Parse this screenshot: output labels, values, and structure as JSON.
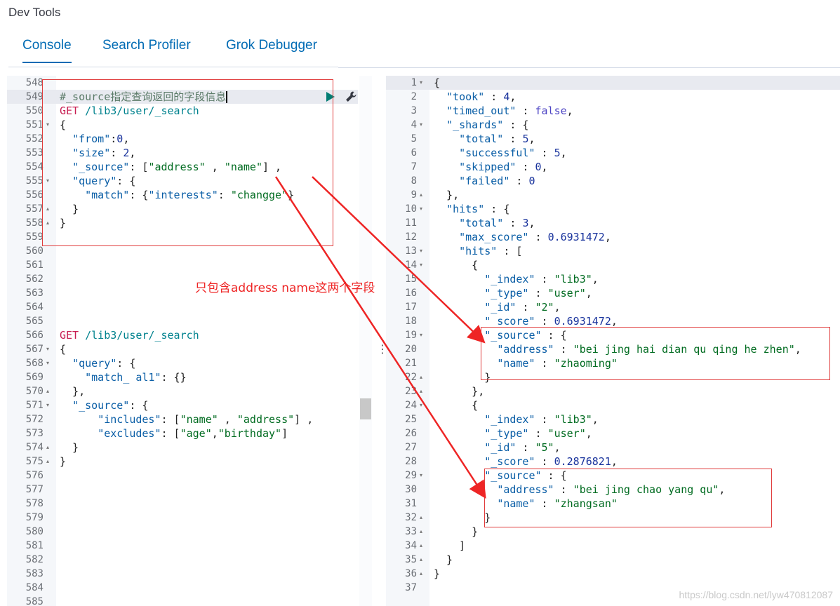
{
  "app": {
    "title": "Dev Tools"
  },
  "tabs": [
    {
      "label": "Console",
      "active": true
    },
    {
      "label": "Search Profiler",
      "active": false
    },
    {
      "label": "Grok Debugger",
      "active": false
    }
  ],
  "request_editor": {
    "lines": [
      {
        "num": "548",
        "tokens": []
      },
      {
        "num": "549",
        "tokens": [
          [
            "cmt",
            "#_source指定查询返回的字段信息"
          ]
        ],
        "cursor": true
      },
      {
        "num": "550",
        "tokens": [
          [
            "verb",
            "GET"
          ],
          [
            "pun",
            " "
          ],
          [
            "url",
            "/lib3/user/_search"
          ]
        ]
      },
      {
        "num": "551",
        "fold": "▾",
        "tokens": [
          [
            "pun",
            "{"
          ]
        ]
      },
      {
        "num": "552",
        "tokens": [
          [
            "pun",
            "  "
          ],
          [
            "key",
            "\"from\""
          ],
          [
            "pun",
            ":"
          ],
          [
            "num",
            "0"
          ],
          [
            "pun",
            ","
          ]
        ]
      },
      {
        "num": "553",
        "tokens": [
          [
            "pun",
            "  "
          ],
          [
            "key",
            "\"size\""
          ],
          [
            "pun",
            ": "
          ],
          [
            "num",
            "2"
          ],
          [
            "pun",
            ","
          ]
        ]
      },
      {
        "num": "554",
        "tokens": [
          [
            "pun",
            "  "
          ],
          [
            "key",
            "\"_source\""
          ],
          [
            "pun",
            ": ["
          ],
          [
            "str",
            "\"address\""
          ],
          [
            "pun",
            " , "
          ],
          [
            "str",
            "\"name\""
          ],
          [
            "pun",
            "] ,"
          ]
        ]
      },
      {
        "num": "555",
        "fold": "▾",
        "tokens": [
          [
            "pun",
            "  "
          ],
          [
            "key",
            "\"query\""
          ],
          [
            "pun",
            ": {"
          ]
        ]
      },
      {
        "num": "556",
        "tokens": [
          [
            "pun",
            "    "
          ],
          [
            "key",
            "\"match\""
          ],
          [
            "pun",
            ": {"
          ],
          [
            "key",
            "\"interests\""
          ],
          [
            "pun",
            ": "
          ],
          [
            "str",
            "\"changge\""
          ],
          [
            "pun",
            "}"
          ]
        ]
      },
      {
        "num": "557",
        "fold": "▴",
        "tokens": [
          [
            "pun",
            "  }"
          ]
        ]
      },
      {
        "num": "558",
        "fold": "▴",
        "tokens": [
          [
            "pun",
            "}"
          ]
        ]
      },
      {
        "num": "559",
        "tokens": []
      },
      {
        "num": "560",
        "tokens": []
      },
      {
        "num": "561",
        "tokens": []
      },
      {
        "num": "562",
        "tokens": []
      },
      {
        "num": "563",
        "tokens": []
      },
      {
        "num": "564",
        "tokens": []
      },
      {
        "num": "565",
        "tokens": []
      },
      {
        "num": "566",
        "tokens": [
          [
            "verb",
            "GET"
          ],
          [
            "pun",
            " "
          ],
          [
            "url",
            "/lib3/user/_search"
          ]
        ]
      },
      {
        "num": "567",
        "fold": "▾",
        "tokens": [
          [
            "pun",
            "{"
          ]
        ]
      },
      {
        "num": "568",
        "fold": "▾",
        "tokens": [
          [
            "pun",
            "  "
          ],
          [
            "key",
            "\"query\""
          ],
          [
            "pun",
            ": {"
          ]
        ]
      },
      {
        "num": "569",
        "tokens": [
          [
            "pun",
            "    "
          ],
          [
            "key",
            "\"match_ al1\""
          ],
          [
            "pun",
            ": {}"
          ]
        ]
      },
      {
        "num": "570",
        "fold": "▴",
        "tokens": [
          [
            "pun",
            "  },"
          ]
        ]
      },
      {
        "num": "571",
        "fold": "▾",
        "tokens": [
          [
            "pun",
            "  "
          ],
          [
            "key",
            "\"_source\""
          ],
          [
            "pun",
            ": {"
          ]
        ]
      },
      {
        "num": "572",
        "tokens": [
          [
            "pun",
            "      "
          ],
          [
            "key",
            "\"includes\""
          ],
          [
            "pun",
            ": ["
          ],
          [
            "str",
            "\"name\""
          ],
          [
            "pun",
            " , "
          ],
          [
            "str",
            "\"address\""
          ],
          [
            "pun",
            "] ,"
          ]
        ]
      },
      {
        "num": "573",
        "tokens": [
          [
            "pun",
            "      "
          ],
          [
            "key",
            "\"excludes\""
          ],
          [
            "pun",
            ": ["
          ],
          [
            "str",
            "\"age\""
          ],
          [
            "pun",
            ","
          ],
          [
            "str",
            "\"birthday\""
          ],
          [
            "pun",
            "]"
          ]
        ]
      },
      {
        "num": "574",
        "fold": "▴",
        "tokens": [
          [
            "pun",
            "  }"
          ]
        ]
      },
      {
        "num": "575",
        "fold": "▴",
        "tokens": [
          [
            "pun",
            "}"
          ]
        ]
      },
      {
        "num": "576",
        "tokens": []
      },
      {
        "num": "577",
        "tokens": []
      },
      {
        "num": "578",
        "tokens": []
      },
      {
        "num": "579",
        "tokens": []
      },
      {
        "num": "580",
        "tokens": []
      },
      {
        "num": "581",
        "tokens": []
      },
      {
        "num": "582",
        "tokens": []
      },
      {
        "num": "583",
        "tokens": []
      },
      {
        "num": "584",
        "tokens": []
      },
      {
        "num": "585",
        "tokens": []
      }
    ],
    "run_icon": "play-icon",
    "settings_icon": "wrench-icon"
  },
  "response_viewer": {
    "lines": [
      {
        "num": "1",
        "fold": "▾",
        "tokens": [
          [
            "pun",
            "{"
          ]
        ]
      },
      {
        "num": "2",
        "tokens": [
          [
            "pun",
            "  "
          ],
          [
            "key",
            "\"took\""
          ],
          [
            "pun",
            " : "
          ],
          [
            "num",
            "4"
          ],
          [
            "pun",
            ","
          ]
        ]
      },
      {
        "num": "3",
        "tokens": [
          [
            "pun",
            "  "
          ],
          [
            "key",
            "\"timed_out\""
          ],
          [
            "pun",
            " : "
          ],
          [
            "bool",
            "false"
          ],
          [
            "pun",
            ","
          ]
        ]
      },
      {
        "num": "4",
        "fold": "▾",
        "tokens": [
          [
            "pun",
            "  "
          ],
          [
            "key",
            "\"_shards\""
          ],
          [
            "pun",
            " : {"
          ]
        ]
      },
      {
        "num": "5",
        "tokens": [
          [
            "pun",
            "    "
          ],
          [
            "key",
            "\"total\""
          ],
          [
            "pun",
            " : "
          ],
          [
            "num",
            "5"
          ],
          [
            "pun",
            ","
          ]
        ]
      },
      {
        "num": "6",
        "tokens": [
          [
            "pun",
            "    "
          ],
          [
            "key",
            "\"successful\""
          ],
          [
            "pun",
            " : "
          ],
          [
            "num",
            "5"
          ],
          [
            "pun",
            ","
          ]
        ]
      },
      {
        "num": "7",
        "tokens": [
          [
            "pun",
            "    "
          ],
          [
            "key",
            "\"skipped\""
          ],
          [
            "pun",
            " : "
          ],
          [
            "num",
            "0"
          ],
          [
            "pun",
            ","
          ]
        ]
      },
      {
        "num": "8",
        "tokens": [
          [
            "pun",
            "    "
          ],
          [
            "key",
            "\"failed\""
          ],
          [
            "pun",
            " : "
          ],
          [
            "num",
            "0"
          ]
        ]
      },
      {
        "num": "9",
        "fold": "▴",
        "tokens": [
          [
            "pun",
            "  },"
          ]
        ]
      },
      {
        "num": "10",
        "fold": "▾",
        "tokens": [
          [
            "pun",
            "  "
          ],
          [
            "key",
            "\"hits\""
          ],
          [
            "pun",
            " : {"
          ]
        ]
      },
      {
        "num": "11",
        "tokens": [
          [
            "pun",
            "    "
          ],
          [
            "key",
            "\"total\""
          ],
          [
            "pun",
            " : "
          ],
          [
            "num",
            "3"
          ],
          [
            "pun",
            ","
          ]
        ]
      },
      {
        "num": "12",
        "tokens": [
          [
            "pun",
            "    "
          ],
          [
            "key",
            "\"max_score\""
          ],
          [
            "pun",
            " : "
          ],
          [
            "num",
            "0.6931472"
          ],
          [
            "pun",
            ","
          ]
        ]
      },
      {
        "num": "13",
        "fold": "▾",
        "tokens": [
          [
            "pun",
            "    "
          ],
          [
            "key",
            "\"hits\""
          ],
          [
            "pun",
            " : ["
          ]
        ]
      },
      {
        "num": "14",
        "fold": "▾",
        "tokens": [
          [
            "pun",
            "      {"
          ]
        ]
      },
      {
        "num": "15",
        "tokens": [
          [
            "pun",
            "        "
          ],
          [
            "key",
            "\"_index\""
          ],
          [
            "pun",
            " : "
          ],
          [
            "str",
            "\"lib3\""
          ],
          [
            "pun",
            ","
          ]
        ]
      },
      {
        "num": "16",
        "tokens": [
          [
            "pun",
            "        "
          ],
          [
            "key",
            "\"_type\""
          ],
          [
            "pun",
            " : "
          ],
          [
            "str",
            "\"user\""
          ],
          [
            "pun",
            ","
          ]
        ]
      },
      {
        "num": "17",
        "tokens": [
          [
            "pun",
            "        "
          ],
          [
            "key",
            "\"_id\""
          ],
          [
            "pun",
            " : "
          ],
          [
            "str",
            "\"2\""
          ],
          [
            "pun",
            ","
          ]
        ]
      },
      {
        "num": "18",
        "tokens": [
          [
            "pun",
            "        "
          ],
          [
            "key",
            "\"_score\""
          ],
          [
            "pun",
            " : "
          ],
          [
            "num",
            "0.6931472"
          ],
          [
            "pun",
            ","
          ]
        ]
      },
      {
        "num": "19",
        "fold": "▾",
        "tokens": [
          [
            "pun",
            "        "
          ],
          [
            "key",
            "\"_source\""
          ],
          [
            "pun",
            " : {"
          ]
        ]
      },
      {
        "num": "20",
        "tokens": [
          [
            "pun",
            "          "
          ],
          [
            "key",
            "\"address\""
          ],
          [
            "pun",
            " : "
          ],
          [
            "str",
            "\"bei jing hai dian qu qing he zhen\""
          ],
          [
            "pun",
            ","
          ]
        ]
      },
      {
        "num": "21",
        "tokens": [
          [
            "pun",
            "          "
          ],
          [
            "key",
            "\"name\""
          ],
          [
            "pun",
            " : "
          ],
          [
            "str",
            "\"zhaoming\""
          ]
        ]
      },
      {
        "num": "22",
        "fold": "▴",
        "tokens": [
          [
            "pun",
            "        }"
          ]
        ]
      },
      {
        "num": "23",
        "fold": "▴",
        "tokens": [
          [
            "pun",
            "      },"
          ]
        ]
      },
      {
        "num": "24",
        "fold": "▾",
        "tokens": [
          [
            "pun",
            "      {"
          ]
        ]
      },
      {
        "num": "25",
        "tokens": [
          [
            "pun",
            "        "
          ],
          [
            "key",
            "\"_index\""
          ],
          [
            "pun",
            " : "
          ],
          [
            "str",
            "\"lib3\""
          ],
          [
            "pun",
            ","
          ]
        ]
      },
      {
        "num": "26",
        "tokens": [
          [
            "pun",
            "        "
          ],
          [
            "key",
            "\"_type\""
          ],
          [
            "pun",
            " : "
          ],
          [
            "str",
            "\"user\""
          ],
          [
            "pun",
            ","
          ]
        ]
      },
      {
        "num": "27",
        "tokens": [
          [
            "pun",
            "        "
          ],
          [
            "key",
            "\"_id\""
          ],
          [
            "pun",
            " : "
          ],
          [
            "str",
            "\"5\""
          ],
          [
            "pun",
            ","
          ]
        ]
      },
      {
        "num": "28",
        "tokens": [
          [
            "pun",
            "        "
          ],
          [
            "key",
            "\"_score\""
          ],
          [
            "pun",
            " : "
          ],
          [
            "num",
            "0.2876821"
          ],
          [
            "pun",
            ","
          ]
        ]
      },
      {
        "num": "29",
        "fold": "▾",
        "tokens": [
          [
            "pun",
            "        "
          ],
          [
            "key",
            "\"_source\""
          ],
          [
            "pun",
            " : {"
          ]
        ]
      },
      {
        "num": "30",
        "tokens": [
          [
            "pun",
            "          "
          ],
          [
            "key",
            "\"address\""
          ],
          [
            "pun",
            " : "
          ],
          [
            "str",
            "\"bei jing chao yang qu\""
          ],
          [
            "pun",
            ","
          ]
        ]
      },
      {
        "num": "31",
        "tokens": [
          [
            "pun",
            "          "
          ],
          [
            "key",
            "\"name\""
          ],
          [
            "pun",
            " : "
          ],
          [
            "str",
            "\"zhangsan\""
          ]
        ]
      },
      {
        "num": "32",
        "fold": "▴",
        "tokens": [
          [
            "pun",
            "        }"
          ]
        ]
      },
      {
        "num": "33",
        "fold": "▴",
        "tokens": [
          [
            "pun",
            "      }"
          ]
        ]
      },
      {
        "num": "34",
        "fold": "▴",
        "tokens": [
          [
            "pun",
            "    ]"
          ]
        ]
      },
      {
        "num": "35",
        "fold": "▴",
        "tokens": [
          [
            "pun",
            "  }"
          ]
        ]
      },
      {
        "num": "36",
        "fold": "▴",
        "tokens": [
          [
            "pun",
            "}"
          ]
        ]
      },
      {
        "num": "37",
        "tokens": []
      }
    ]
  },
  "annotation": {
    "text": "只包含address  name这两个字段",
    "color": "#ee2525"
  },
  "splitter": {
    "handle": "⋮"
  },
  "watermark": "https://blog.csdn.net/lyw470812087",
  "colors": {
    "accent": "#006bb4",
    "annotation": "#e03c3c",
    "active_line": "#e8eaf0"
  }
}
